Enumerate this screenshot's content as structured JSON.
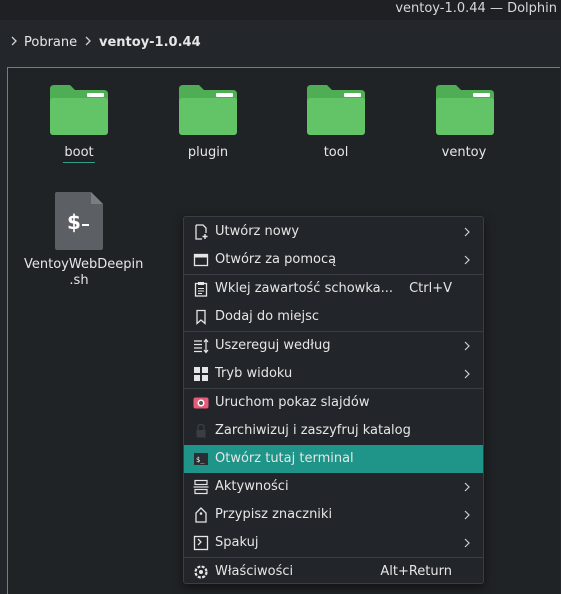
{
  "window": {
    "title": "ventoy-1.0.44 — Dolphin"
  },
  "breadcrumb": {
    "items": [
      "Pobrane",
      "ventoy-1.0.44"
    ]
  },
  "files": [
    {
      "name": "boot",
      "type": "folder",
      "icon": "folder-icon"
    },
    {
      "name": "plugin",
      "type": "folder",
      "icon": "folder-icon"
    },
    {
      "name": "tool",
      "type": "folder",
      "icon": "folder-icon"
    },
    {
      "name": "ventoy",
      "type": "folder",
      "icon": "folder-icon"
    },
    {
      "name_line1": "VentoyWebDeepin",
      "name_line2": ".sh",
      "type": "script",
      "icon": "shell-script-icon"
    }
  ],
  "context_menu": {
    "items": [
      {
        "label": "Utwórz nowy",
        "icon": "new-document-icon",
        "submenu": true
      },
      {
        "label": "Otwórz za pomocą",
        "icon": "open-with-icon",
        "submenu": true
      },
      {
        "label": "Wklej zawartość schowka...",
        "icon": "paste-icon",
        "shortcut": "Ctrl+V"
      },
      {
        "label": "Dodaj do miejsc",
        "icon": "bookmark-icon"
      },
      {
        "label": "Uszereguj według",
        "icon": "sort-icon",
        "submenu": true
      },
      {
        "label": "Tryb widoku",
        "icon": "view-mode-icon",
        "submenu": true
      },
      {
        "label": "Uruchom pokaz slajdów",
        "icon": "slideshow-icon"
      },
      {
        "label": "Zarchiwizuj i zaszyfruj katalog",
        "icon": "lock-icon"
      },
      {
        "label": "Otwórz tutaj terminal",
        "icon": "terminal-icon",
        "active": true
      },
      {
        "label": "Aktywności",
        "icon": "activities-icon",
        "submenu": true
      },
      {
        "label": "Przypisz znaczniki",
        "icon": "tag-icon",
        "submenu": true
      },
      {
        "label": "Spakuj",
        "icon": "compress-icon",
        "submenu": true
      },
      {
        "label": "Właściwości",
        "icon": "properties-icon",
        "shortcut": "Alt+Return"
      }
    ]
  },
  "colors": {
    "accent": "#1f9488",
    "folder": "#5bbf60",
    "background": "#202326"
  }
}
